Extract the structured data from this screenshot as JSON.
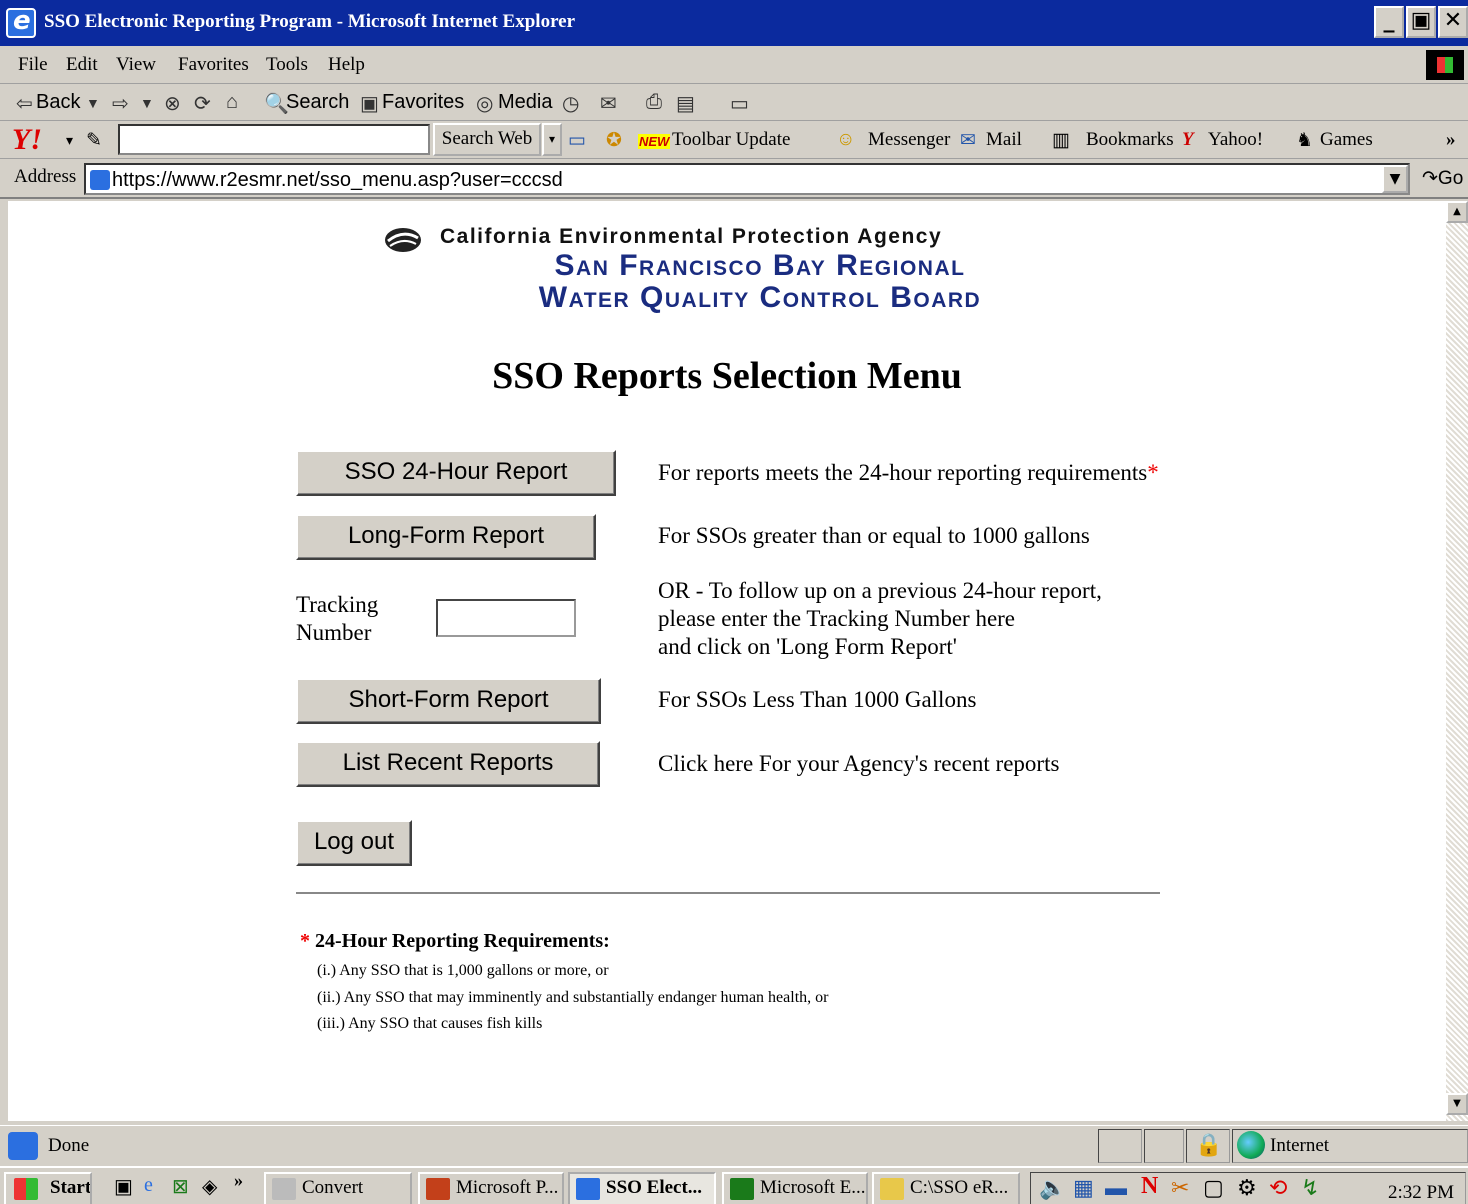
{
  "window": {
    "title": "SSO Electronic Reporting Program - Microsoft Internet Explorer",
    "controls": [
      "_",
      "▣",
      "✕"
    ]
  },
  "menu": [
    "File",
    "Edit",
    "View",
    "Favorites",
    "Tools",
    "Help"
  ],
  "std_toolbar": {
    "back": "Back",
    "search": "Search",
    "favorites": "Favorites",
    "media": "Media"
  },
  "yahoo_toolbar": {
    "logo": "Y!",
    "search_button": "Search Web",
    "new_badge": "NEW",
    "toolbar_update": "Toolbar Update",
    "messenger": "Messenger",
    "mail": "Mail",
    "bookmarks": "Bookmarks",
    "yahoo": "Yahoo!",
    "games": "Games",
    "more": "»"
  },
  "address": {
    "label": "Address",
    "url": "https://www.r2esmr.net/sso_menu.asp?user=cccsd",
    "go": "Go"
  },
  "page": {
    "agency_line1": "California Environmental Protection Agency",
    "agency_line2": "San Francisco Bay Regional",
    "agency_line3": "Water Quality Control Board",
    "title": "SSO Reports Selection Menu",
    "rows": [
      {
        "button": "SSO 24-Hour Report",
        "desc": "For reports meets the 24-hour reporting requirements",
        "star": "*"
      },
      {
        "button": "Long-Form Report",
        "desc": "For SSOs greater than or equal to 1000 gallons"
      },
      {
        "button": "Short-Form Report",
        "desc": "For SSOs Less Than 1000 Gallons"
      },
      {
        "button": "List Recent Reports",
        "desc": "Click here For your Agency's recent reports"
      }
    ],
    "tracking": {
      "label_line1": "Tracking",
      "label_line2": "Number",
      "value": "",
      "desc_line1": "OR - To follow up on a previous 24-hour report,",
      "desc_line2": "please enter the Tracking Number here",
      "desc_line3": "and click on 'Long Form Report'"
    },
    "logout": "Log out",
    "requirements": {
      "star": "*",
      "title": "24-Hour Reporting Requirements:",
      "items": [
        "(i.)   Any SSO that is 1,000 gallons or more, or",
        "(ii.)  Any SSO that may imminently and substantially endanger human health, or",
        "(iii.) Any SSO that causes fish kills"
      ]
    }
  },
  "status": {
    "text": "Done",
    "zone": "Internet"
  },
  "taskbar": {
    "start": "Start",
    "more": "»",
    "buttons": [
      "Convert",
      "Microsoft P...",
      "SSO Elect...",
      "Microsoft E...",
      "C:\\SSO eR..."
    ],
    "clock": "2:32 PM"
  },
  "colors": {
    "title_bar": "#0b2a9e",
    "logo_blue": "#1a2c80",
    "required_star": "#ee0000"
  }
}
